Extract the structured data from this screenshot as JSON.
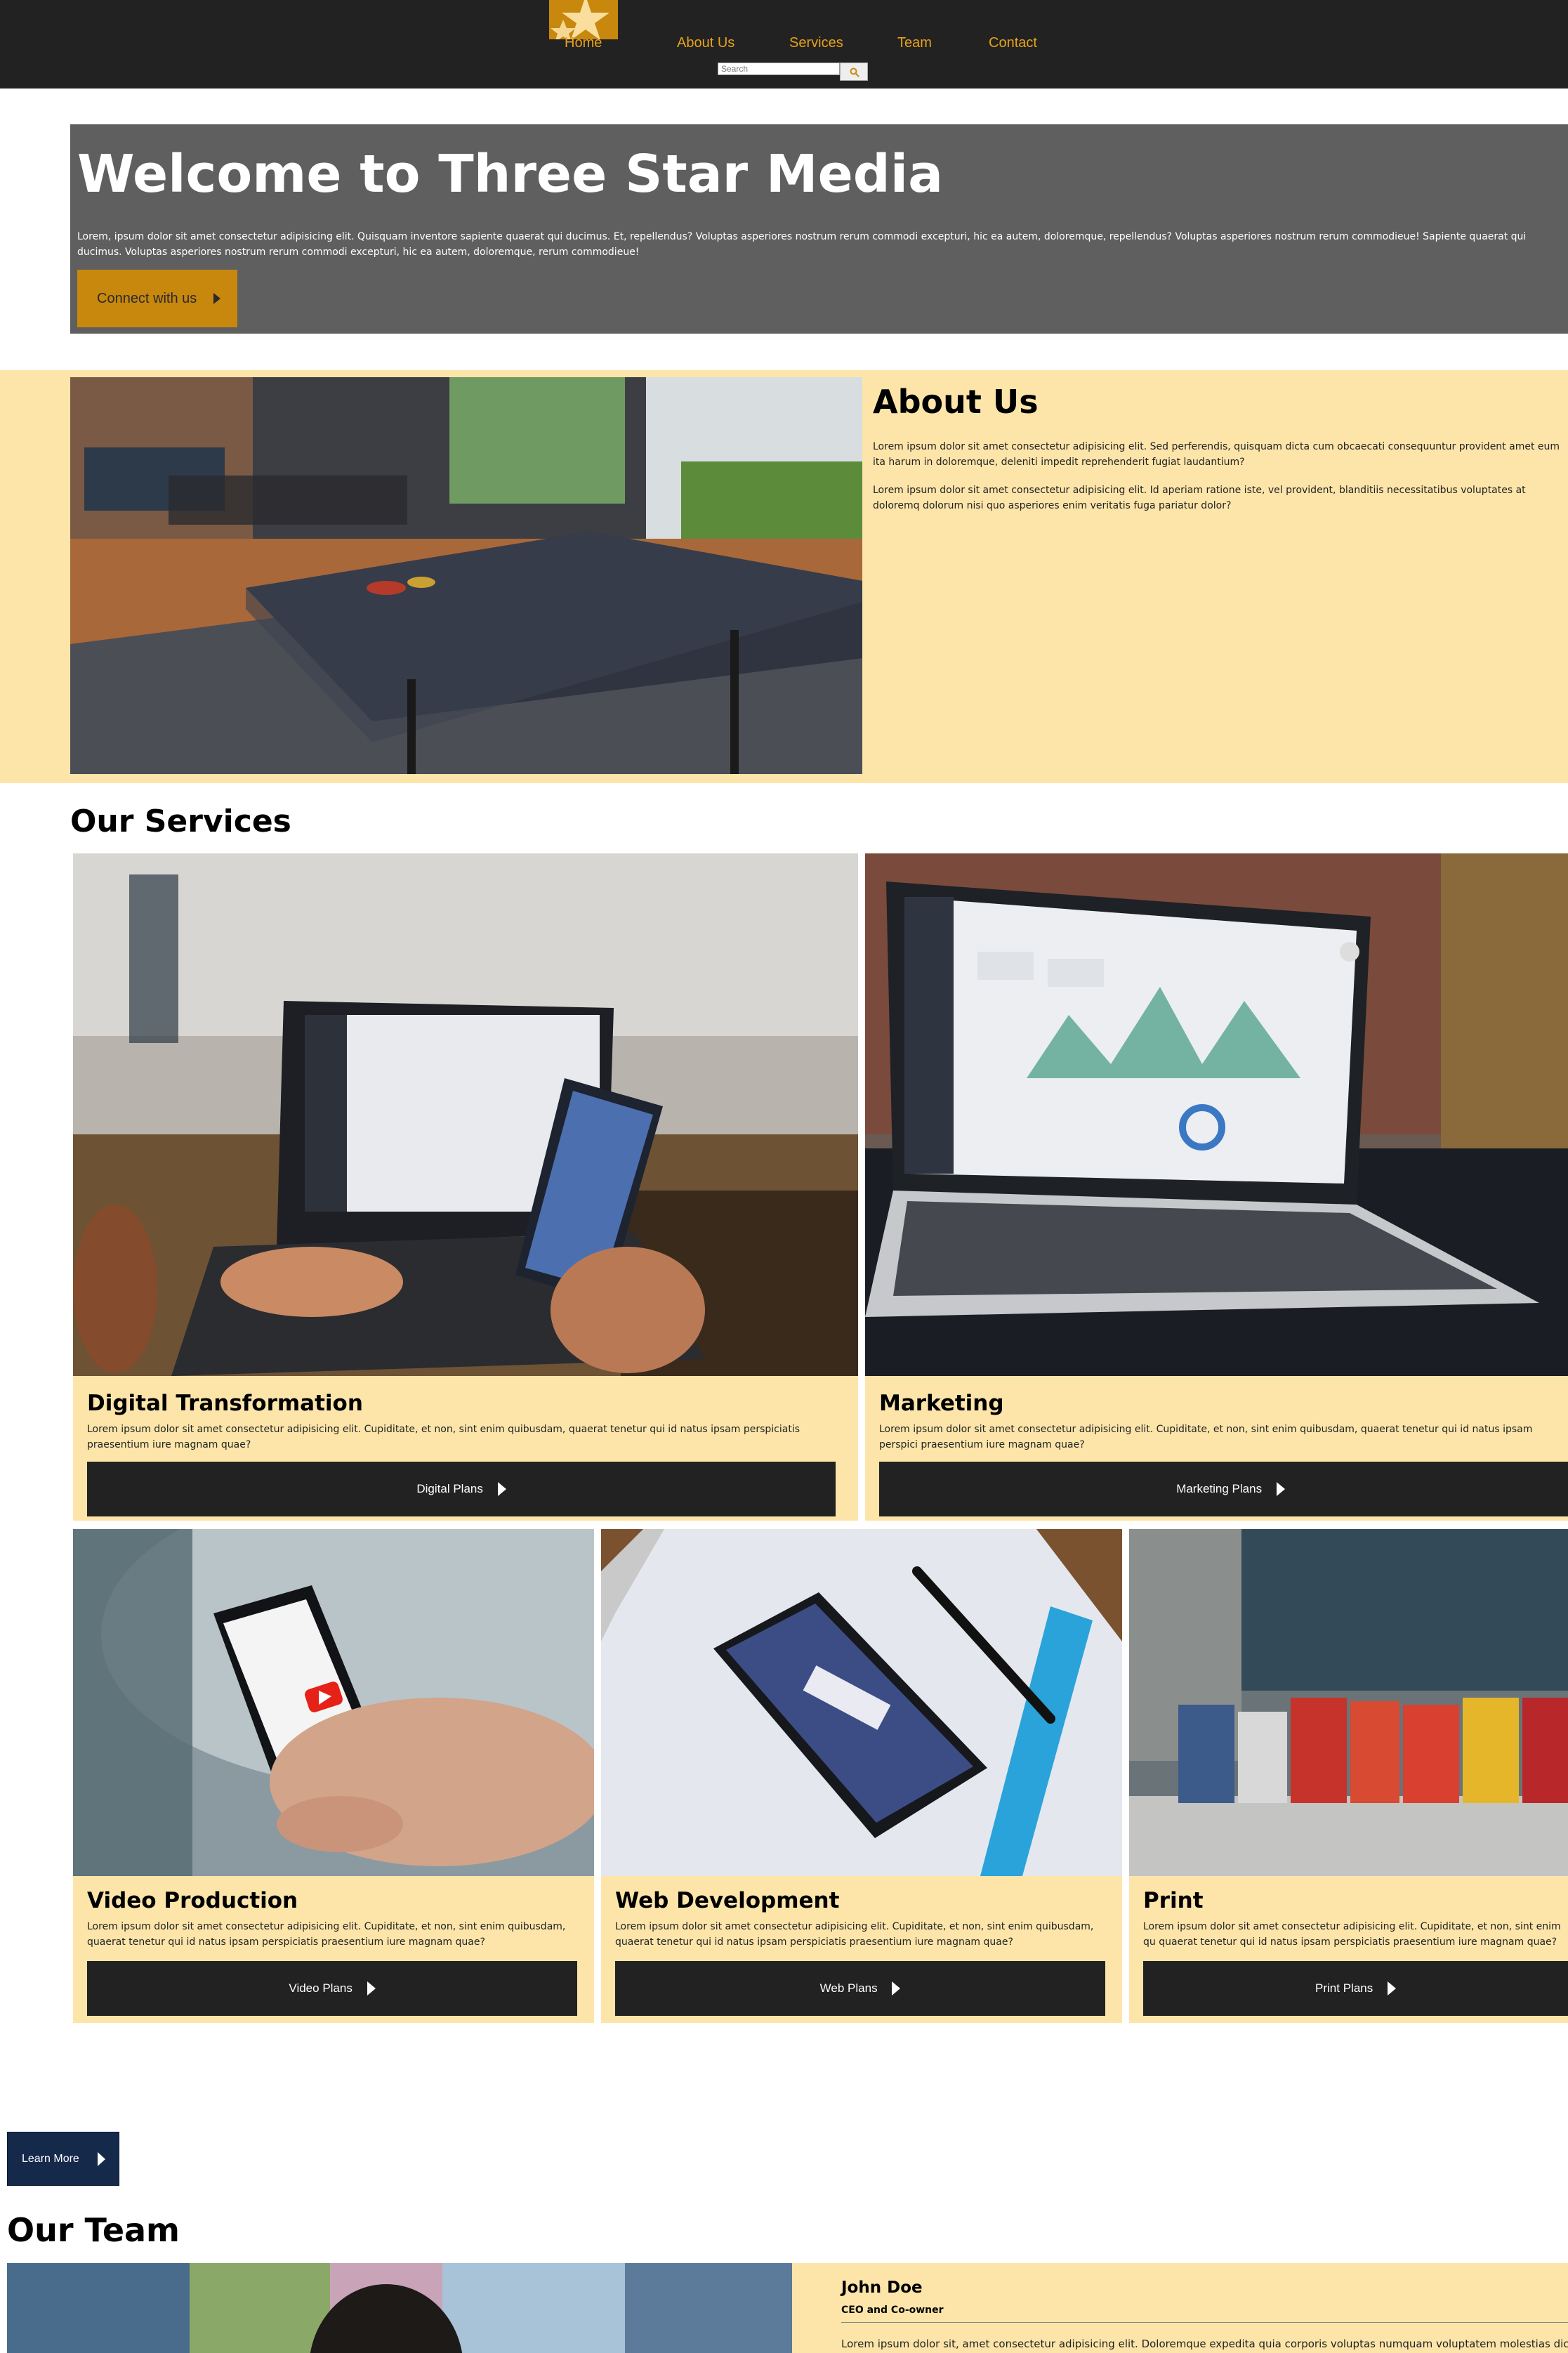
{
  "nav": {
    "links": [
      "Home",
      "About Us",
      "Services",
      "Team",
      "Contact"
    ],
    "search_placeholder": "Search"
  },
  "hero": {
    "title": "Welcome to Three Star Media",
    "text": "Lorem, ipsum dolor sit amet consectetur adipisicing elit. Quisquam inventore sapiente quaerat qui ducimus. Et, repellendus? Voluptas asperiores nostrum rerum commodi excepturi, hic ea autem, doloremque, repellendus? Voluptas asperiores nostrum rerum commodieue! Sapiente quaerat qui ducimus. Voluptas asperiores nostrum rerum commodi excepturi, hic ea autem, doloremque, rerum commodieue!",
    "button": "Connect with us"
  },
  "about": {
    "title": "About Us",
    "p1": "Lorem ipsum dolor sit amet consectetur adipisicing elit. Sed perferendis, quisquam dicta cum obcaecati consequuntur provident amet eum ita harum in doloremque, deleniti impedit reprehenderit fugiat laudantium?",
    "p2": "Lorem ipsum dolor sit amet consectetur adipisicing elit. Id aperiam ratione iste, vel provident, blanditiis necessitatibus voluptates at doloremq dolorum nisi quo asperiores enim veritatis fuga pariatur dolor?"
  },
  "services": {
    "title": "Our Services",
    "items": [
      {
        "title": "Digital Transformation",
        "text": "Lorem ipsum dolor sit amet consectetur adipisicing elit. Cupiditate, et non, sint enim quibusdam, quaerat tenetur qui id natus ipsam perspiciatis praesentium iure magnam quae?",
        "button": "Digital Plans"
      },
      {
        "title": "Marketing",
        "text": "Lorem ipsum dolor sit amet consectetur adipisicing elit. Cupiditate, et non, sint enim quibusdam, quaerat tenetur qui id natus ipsam perspici praesentium iure magnam quae?",
        "button": "Marketing Plans"
      },
      {
        "title": "Video Production",
        "text": "Lorem ipsum dolor sit amet consectetur adipisicing elit. Cupiditate, et non, sint enim quibusdam, quaerat tenetur qui id natus ipsam perspiciatis praesentium iure magnam quae?",
        "button": "Video Plans"
      },
      {
        "title": "Web Development",
        "text": "Lorem ipsum dolor sit amet consectetur adipisicing elit. Cupiditate, et non, sint enim quibusdam, quaerat tenetur qui id natus ipsam perspiciatis praesentium iure magnam quae?",
        "button": "Web Plans"
      },
      {
        "title": "Print",
        "text": "Lorem ipsum dolor sit amet consectetur adipisicing elit. Cupiditate, et non, sint enim qu quaerat tenetur qui id natus ipsam perspiciatis praesentium iure magnam quae?",
        "button": "Print Plans"
      }
    ],
    "learn_more": "Learn More"
  },
  "team": {
    "title": "Our Team",
    "member": {
      "name": "John Doe",
      "role": "CEO and Co-owner",
      "bio": "Lorem ipsum dolor sit, amet consectetur adipisicing elit. Doloremque expedita quia corporis voluptas numquam voluptatem molestias dicta itaque"
    }
  },
  "colors": {
    "nav_bg": "#222222",
    "accent_gold": "#c8870d",
    "nav_link": "#e8a21a",
    "hero_bg": "#5f5f5f",
    "section_cream": "#fde5aa",
    "button_dark": "#222222",
    "learn_more_navy": "#152a4b"
  }
}
